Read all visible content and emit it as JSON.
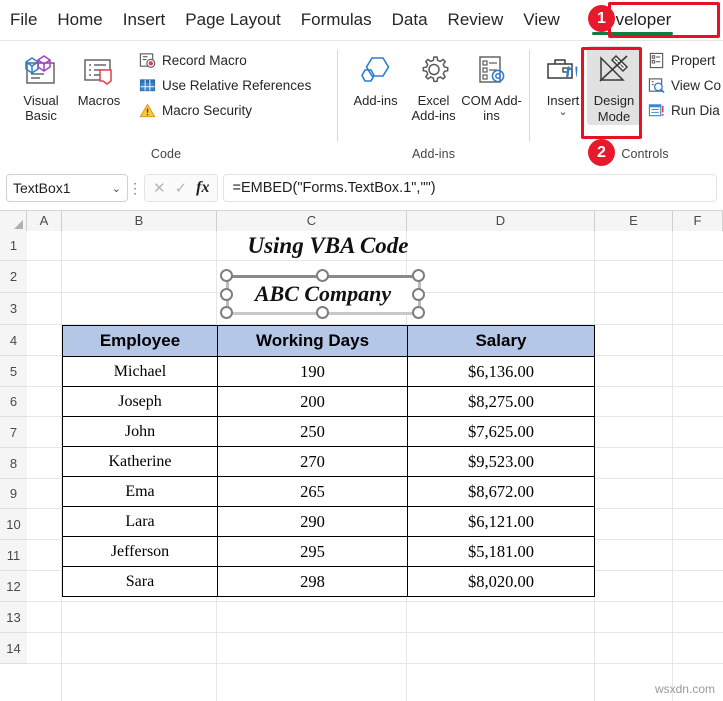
{
  "ribbon": {
    "tabs": [
      {
        "label": "File",
        "active": false
      },
      {
        "label": "Home",
        "active": false
      },
      {
        "label": "Insert",
        "active": false
      },
      {
        "label": "Page Layout",
        "active": false
      },
      {
        "label": "Formulas",
        "active": false
      },
      {
        "label": "Data",
        "active": false
      },
      {
        "label": "Review",
        "active": false
      },
      {
        "label": "View",
        "active": false
      },
      {
        "label": "Developer",
        "active": true
      }
    ],
    "groups": {
      "code": {
        "label": "Code",
        "visual_basic": "Visual Basic",
        "macros": "Macros",
        "record_macro": "Record Macro",
        "use_relative_references": "Use Relative References",
        "macro_security": "Macro Security"
      },
      "addins": {
        "label": "Add-ins",
        "addins": "Add-ins",
        "excel_addins": "Excel Add-ins",
        "com_addins": "COM Add-ins"
      },
      "controls": {
        "label": "Controls",
        "insert": "Insert",
        "design_mode": "Design Mode",
        "properties": "Propert",
        "view_code": "View Co",
        "run_dialog": "Run Dia"
      }
    },
    "annotations": {
      "step1": "1",
      "step2": "2",
      "accent_color": "#e8192c",
      "active_tab_color": "#107c41"
    }
  },
  "formula_bar": {
    "name_box_value": "TextBox1",
    "cancel_icon": "✕",
    "enter_icon": "✓",
    "function_icon": "fx",
    "formula_value": "=EMBED(\"Forms.TextBox.1\",\"\")"
  },
  "grid": {
    "columns": [
      "A",
      "B",
      "C",
      "D",
      "E",
      "F"
    ],
    "rows": [
      "1",
      "2",
      "3",
      "4",
      "5",
      "6",
      "7",
      "8",
      "9",
      "10",
      "11",
      "12",
      "13",
      "14"
    ],
    "sheet_title": "Using VBA Code",
    "textbox_control": {
      "name": "TextBox1",
      "value": "ABC Company",
      "selected": true
    }
  },
  "table": {
    "headers": [
      "Employee",
      "Working Days",
      "Salary"
    ],
    "header_fill": "#b4c7e7",
    "rows": [
      [
        "Michael",
        "190",
        "$6,136.00"
      ],
      [
        "Joseph",
        "200",
        "$8,275.00"
      ],
      [
        "John",
        "250",
        "$7,625.00"
      ],
      [
        "Katherine",
        "270",
        "$9,523.00"
      ],
      [
        "Ema",
        "265",
        "$8,672.00"
      ],
      [
        "Lara",
        "290",
        "$6,121.00"
      ],
      [
        "Jefferson",
        "295",
        "$5,181.00"
      ],
      [
        "Sara",
        "298",
        "$8,020.00"
      ]
    ]
  },
  "watermark": "wsxdn.com"
}
